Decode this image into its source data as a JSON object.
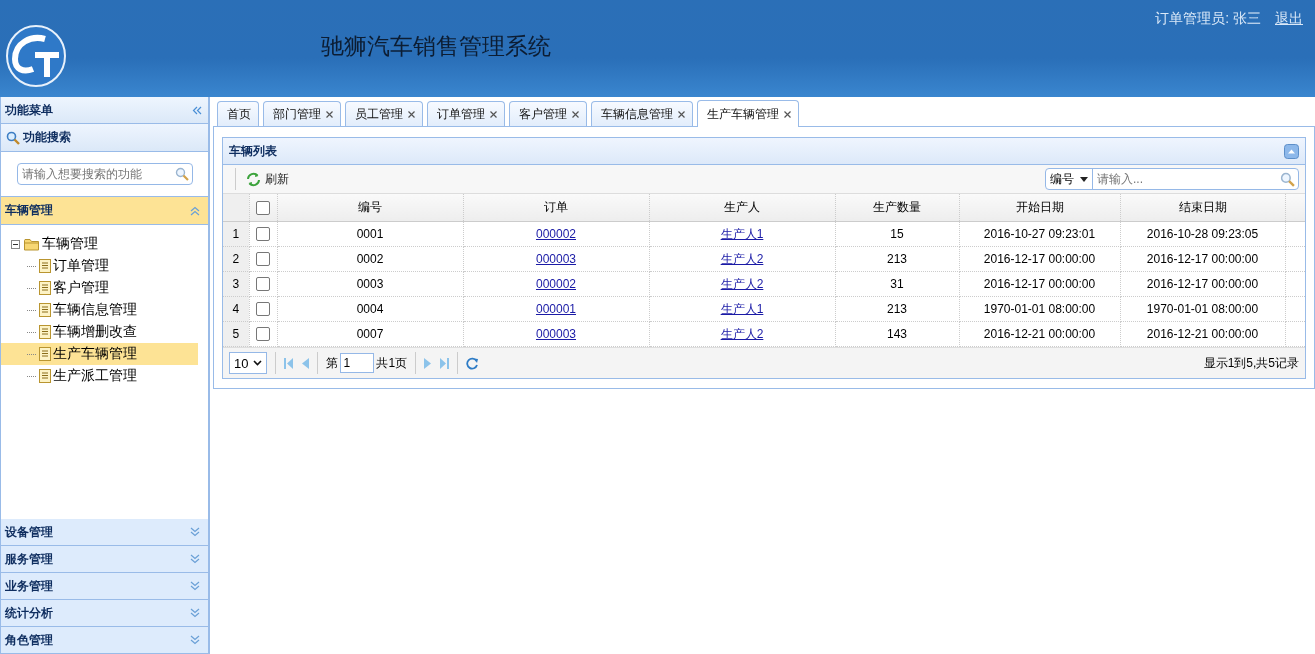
{
  "header": {
    "title": "驰狮汽车销售管理系统",
    "user_label": "订单管理员: 张三",
    "logout": "退出"
  },
  "sidebar": {
    "title": "功能菜单",
    "search_title": "功能搜索",
    "search": {
      "placeholder": "请输入想要搜索的功能"
    },
    "sections": [
      {
        "label": "车辆管理",
        "expanded": true,
        "tree": [
          {
            "label": "车辆管理",
            "kind": "folder",
            "expanded": true,
            "selected": false,
            "children": [
              {
                "label": "订单管理",
                "kind": "page",
                "selected": false
              },
              {
                "label": "客户管理",
                "kind": "page",
                "selected": false
              },
              {
                "label": "车辆信息管理",
                "kind": "page",
                "selected": false
              },
              {
                "label": "车辆增删改查",
                "kind": "page",
                "selected": false
              },
              {
                "label": "生产车辆管理",
                "kind": "page",
                "selected": true
              },
              {
                "label": "生产派工管理",
                "kind": "page",
                "selected": false
              }
            ]
          }
        ]
      },
      {
        "label": "设备管理",
        "expanded": false
      },
      {
        "label": "服务管理",
        "expanded": false
      },
      {
        "label": "业务管理",
        "expanded": false
      },
      {
        "label": "统计分析",
        "expanded": false
      },
      {
        "label": "角色管理",
        "expanded": false
      }
    ]
  },
  "tabs": [
    {
      "label": "首页",
      "closable": false,
      "selected": false
    },
    {
      "label": "部门管理",
      "closable": true,
      "selected": false
    },
    {
      "label": "员工管理",
      "closable": true,
      "selected": false
    },
    {
      "label": "订单管理",
      "closable": true,
      "selected": false
    },
    {
      "label": "客户管理",
      "closable": true,
      "selected": false
    },
    {
      "label": "车辆信息管理",
      "closable": true,
      "selected": false
    },
    {
      "label": "生产车辆管理",
      "closable": true,
      "selected": true
    }
  ],
  "panel": {
    "title": "车辆列表",
    "refresh": "刷新",
    "search_field": "编号",
    "search_placeholder": "请输入...",
    "all_checked": false,
    "columns": [
      "编号",
      "订单",
      "生产人",
      "生产数量",
      "开始日期",
      "结束日期"
    ],
    "rows": [
      {
        "number": "1",
        "checked": false,
        "id": "0001",
        "order": "000002",
        "producer": "生产人1",
        "quantity": "15",
        "start": "2016-10-27 09:23:01",
        "end": "2016-10-28 09:23:05"
      },
      {
        "number": "2",
        "checked": false,
        "id": "0002",
        "order": "000003",
        "producer": "生产人2",
        "quantity": "213",
        "start": "2016-12-17 00:00:00",
        "end": "2016-12-17 00:00:00"
      },
      {
        "number": "3",
        "checked": false,
        "id": "0003",
        "order": "000002",
        "producer": "生产人2",
        "quantity": "31",
        "start": "2016-12-17 00:00:00",
        "end": "2016-12-17 00:00:00"
      },
      {
        "number": "4",
        "checked": false,
        "id": "0004",
        "order": "000001",
        "producer": "生产人1",
        "quantity": "213",
        "start": "1970-01-01 08:00:00",
        "end": "1970-01-01 08:00:00"
      },
      {
        "number": "5",
        "checked": false,
        "id": "0007",
        "order": "000003",
        "producer": "生产人2",
        "quantity": "143",
        "start": "2016-12-21 00:00:00",
        "end": "2016-12-21 00:00:00"
      }
    ],
    "pager": {
      "page_size": "10",
      "page_prefix": "第",
      "page": "1",
      "page_suffix": "共1页",
      "summary": "显示1到5,共5记录"
    }
  }
}
